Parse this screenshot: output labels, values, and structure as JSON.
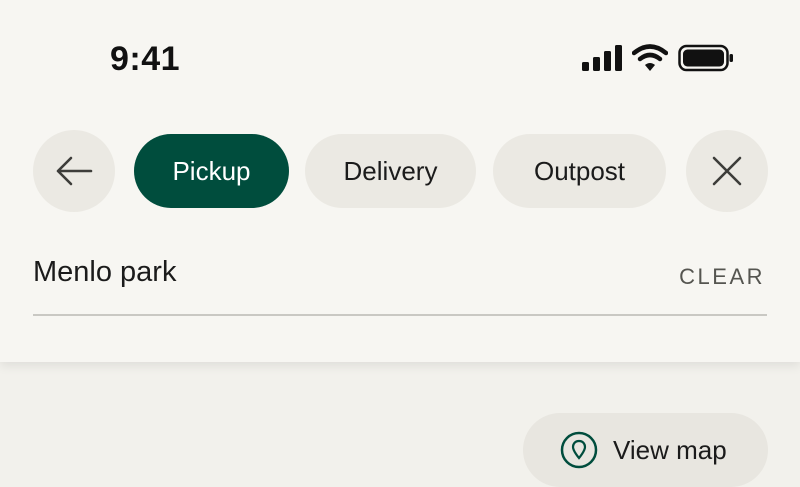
{
  "status_bar": {
    "time": "9:41"
  },
  "filter": {
    "back_icon": "arrow-left-icon",
    "close_icon": "close-icon",
    "chips": [
      {
        "label": "Pickup",
        "selected": true
      },
      {
        "label": "Delivery",
        "selected": false
      },
      {
        "label": "Outpost",
        "selected": false
      }
    ]
  },
  "search": {
    "value": "Menlo park",
    "clear_label": "CLEAR"
  },
  "map_button": {
    "label": "View map",
    "icon": "location-pin-icon"
  },
  "colors": {
    "accent": "#004d3d",
    "background": "#f7f6f2",
    "chip_background": "#ebe9e3"
  }
}
